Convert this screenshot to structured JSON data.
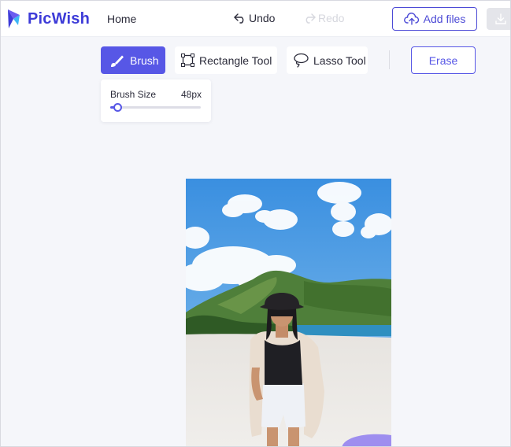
{
  "header": {
    "logo_text": "PicWish",
    "nav_home": "Home",
    "undo_label": "Undo",
    "redo_label": "Redo",
    "add_files_label": "Add files"
  },
  "toolbar": {
    "brush_label": "Brush",
    "rectangle_label": "Rectangle Tool",
    "lasso_label": "Lasso Tool",
    "erase_label": "Erase",
    "active_tool": "Brush"
  },
  "brush_panel": {
    "label": "Brush Size",
    "value_text": "48px",
    "slider_fraction": 0.08
  },
  "colors": {
    "accent": "#5757e6",
    "brand": "#3d3bd8",
    "background": "#f5f6fa"
  },
  "icons": {
    "logo": "picwish-logo-icon",
    "undo": "undo-icon",
    "redo": "redo-icon",
    "upload": "upload-cloud-icon",
    "download": "download-icon",
    "brush": "brush-icon",
    "rectangle": "rectangle-select-icon",
    "lasso": "lasso-icon"
  }
}
